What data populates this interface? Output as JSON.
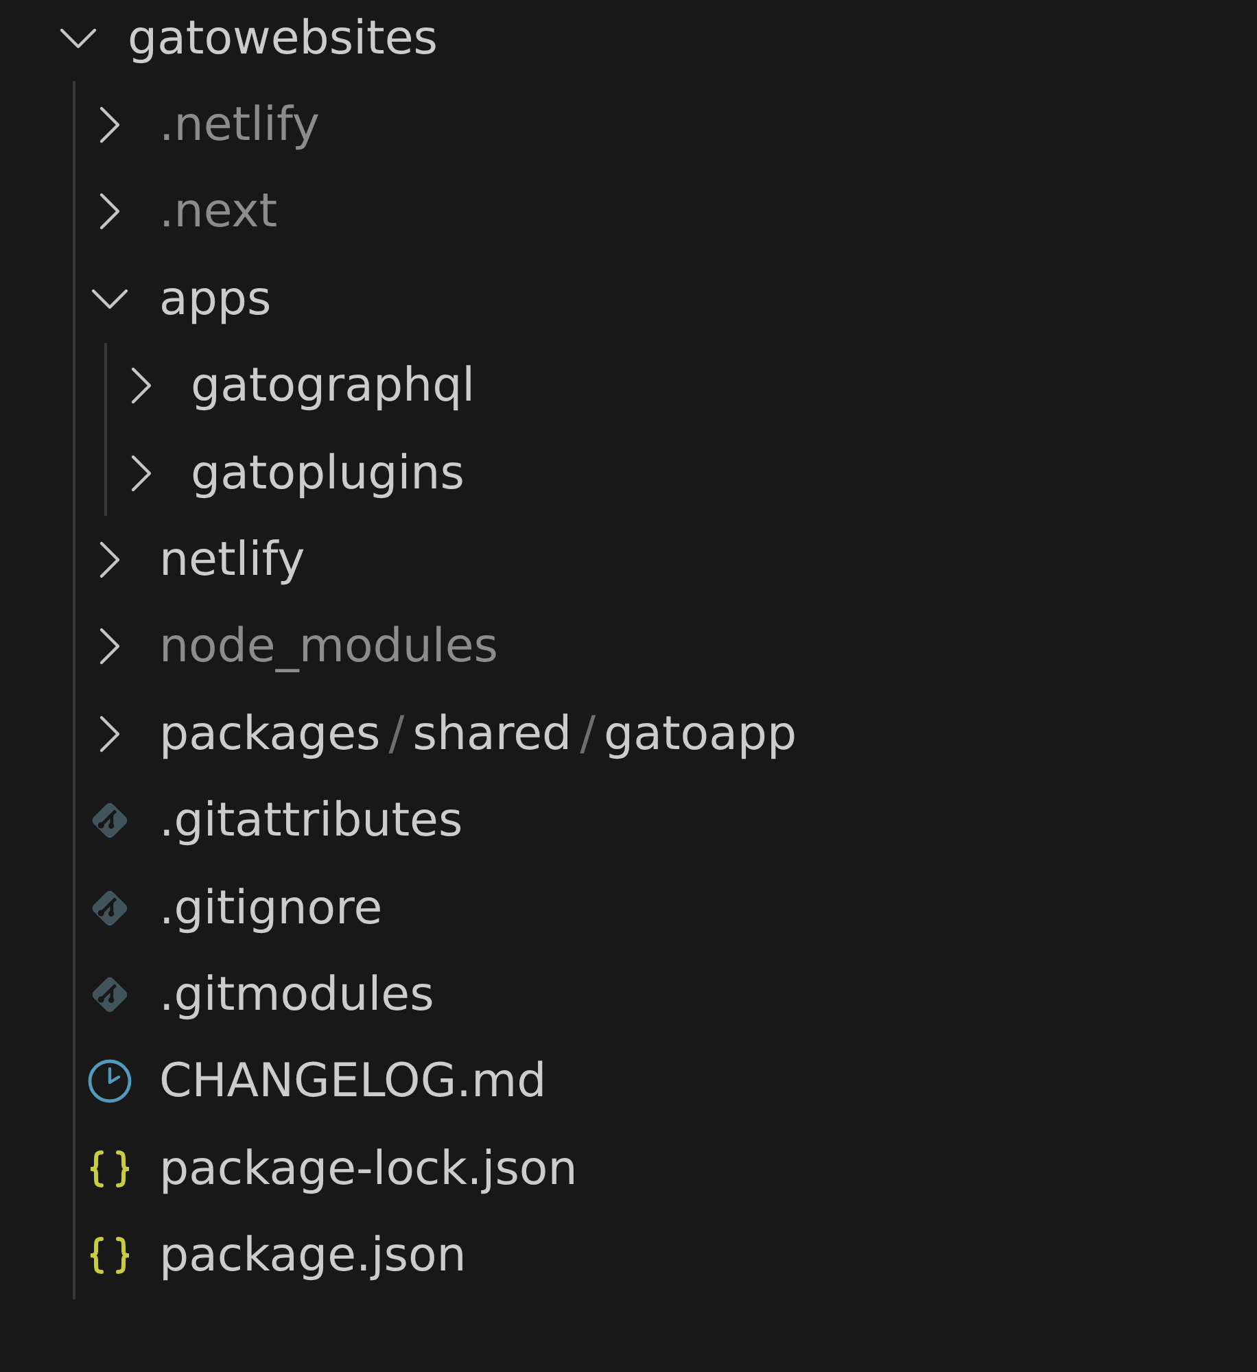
{
  "explorer": {
    "items": [
      {
        "kind": "folder",
        "label": "gatowebsites",
        "expanded": true,
        "ignored": false,
        "children": [
          {
            "kind": "folder",
            "label": ".netlify",
            "expanded": false,
            "ignored": true
          },
          {
            "kind": "folder",
            "label": ".next",
            "expanded": false,
            "ignored": true
          },
          {
            "kind": "folder",
            "label": "apps",
            "expanded": true,
            "ignored": false,
            "children": [
              {
                "kind": "folder",
                "label": "gatographql",
                "expanded": false,
                "ignored": false
              },
              {
                "kind": "folder",
                "label": "gatoplugins",
                "expanded": false,
                "ignored": false
              }
            ]
          },
          {
            "kind": "folder",
            "label": "netlify",
            "expanded": false,
            "ignored": false
          },
          {
            "kind": "folder",
            "label": "node_modules",
            "expanded": false,
            "ignored": true
          },
          {
            "kind": "folder",
            "segments": [
              "packages",
              "shared",
              "gatoapp"
            ],
            "separators": [
              "/",
              "/"
            ],
            "expanded": false,
            "ignored": false
          },
          {
            "kind": "git",
            "label": ".gitattributes",
            "ignored": false
          },
          {
            "kind": "git",
            "label": ".gitignore",
            "ignored": false
          },
          {
            "kind": "git",
            "label": ".gitmodules",
            "ignored": false
          },
          {
            "kind": "changelog",
            "label": "CHANGELOG.md",
            "ignored": false
          },
          {
            "kind": "json",
            "label": "package-lock.json",
            "ignored": false
          },
          {
            "kind": "json",
            "label": "package.json",
            "ignored": false
          }
        ]
      }
    ]
  }
}
